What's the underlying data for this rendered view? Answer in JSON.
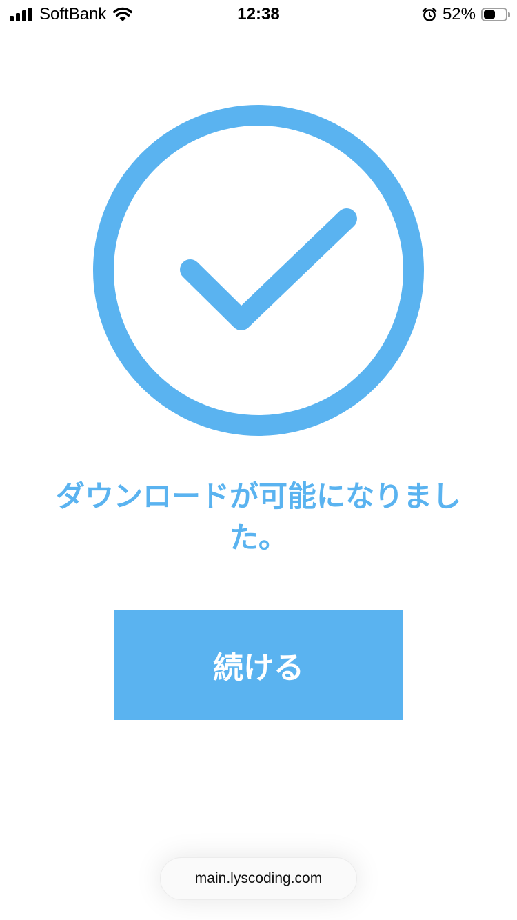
{
  "status_bar": {
    "carrier": "SoftBank",
    "time": "12:38",
    "battery_percent": "52%",
    "battery_level": 0.52,
    "signal_bars": 4,
    "icons": [
      "signal-icon",
      "wifi-icon",
      "alarm-icon",
      "battery-icon"
    ]
  },
  "main": {
    "graphic_icon": "check-circle-icon",
    "message": "ダウンロードが可能になりました。",
    "continue_label": "続ける"
  },
  "browser": {
    "url": "main.lyscoding.com"
  },
  "colors": {
    "accent": "#5ab3f0",
    "background": "#ffffff",
    "button_text": "#ffffff"
  }
}
